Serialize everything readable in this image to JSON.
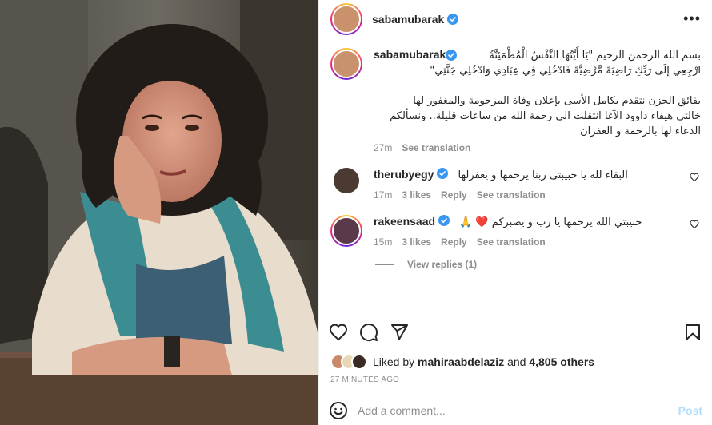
{
  "post": {
    "author": "sabamubarak",
    "caption_lines": [
      "بسم الله الرحمن الرحيم \"يَا أَيَّتُهَا النَّفْسُ الْمُطْمَئِنَّةُ",
      "ارْجِعِي إِلَى رَبِّكِ رَاضِيَةً مَّرْضِيَّةً فَادْخُلِي فِي عِبَادِي وَادْخُلِي جَنَّتِي\"",
      "",
      "بفائق الحزن نتقدم بكامل الأسى بإعلان وفاة المرحومة والمغفور لها",
      "خالتي هيفاء داوود الآغا انتقلت الى رحمة الله من ساعات قليلة.. ونسألكم",
      "الدعاء لها بالرحمة و الغفران"
    ],
    "caption_time": "27m",
    "see_translation": "See translation"
  },
  "comments": [
    {
      "user": "therubyegy",
      "text": "البقاء لله يا حبيبتى ربنا يرحمها و يغفرلها",
      "time": "17m",
      "likes": "3 likes",
      "reply": "Reply",
      "translate": "See translation"
    },
    {
      "user": "rakeensaad",
      "text": "حبيبتي الله يرحمها يا رب و يصبركم ❤️ 🙏",
      "time": "15m",
      "likes": "3 likes",
      "reply": "Reply",
      "translate": "See translation",
      "view_replies": "View replies (1)"
    }
  ],
  "likes": {
    "prefix": "Liked by ",
    "user": "mahiraabdelaziz",
    "middle": " and ",
    "others": "4,805 others"
  },
  "time_ago": "27 MINUTES AGO",
  "add_comment": {
    "placeholder": "Add a comment...",
    "post_label": "Post"
  },
  "icons": {
    "more": "more-options-icon",
    "like": "heart-icon",
    "comment": "comment-bubble-icon",
    "share": "send-paper-plane-icon",
    "save": "bookmark-icon",
    "emoji": "emoji-smiley-icon",
    "verified": "verified-badge-icon"
  },
  "colors": {
    "verified": "#3897f0",
    "post_disabled": "#b2dffc",
    "muted": "#8e8e8e",
    "text": "#262626"
  }
}
